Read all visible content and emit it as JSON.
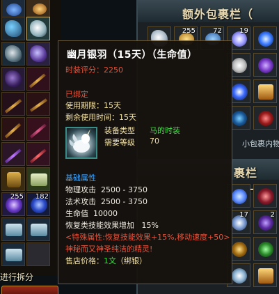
{
  "tooltip": {
    "title": "幽月银羽（15天）（生命值）",
    "score_label": "时装评分：",
    "score_value": "2250",
    "bound": "已绑定",
    "use_period_label": "使用期限：",
    "use_period_value": "15天",
    "remaining_label": "剩余使用时间：",
    "remaining_value": "15天",
    "equip_type_label": "装备类型",
    "equip_type_value": "马的时装",
    "req_level_label": "需要等级",
    "req_level_value": "70",
    "base_attr_header": "基础属性",
    "phys_atk_label": "物理攻击",
    "phys_atk_value": "2500 - 3750",
    "magic_atk_label": "法术攻击",
    "magic_atk_value": "2500 - 3750",
    "hp_label": "生命值",
    "hp_value": "10000",
    "recovery_label": "恢复类技能效果增加",
    "recovery_value": "15%",
    "special_attr": "<特殊属性:恢复技能效果+15%,移动速度+50>",
    "flavor": "神秘而又神圣纯洁的精灵!",
    "price_label": "售店价格：",
    "price_value": "1文",
    "price_bound": "（绑银）"
  },
  "right_panel_top": {
    "title": "额外包裹栏（",
    "slot_counts": [
      "255",
      "72",
      "19"
    ],
    "faded_counts": [
      "15",
      "20"
    ],
    "ghost_text": "小包裹内物"
  },
  "right_panel_bottom": {
    "title": "裹栏（一",
    "faded_title": "额外包",
    "slot_counts": [
      "17",
      "2"
    ]
  },
  "left_inventory": {
    "slot_counts": [
      "255",
      "182"
    ],
    "split_label": "进行拆分"
  },
  "colors": {
    "title": "#ffffff",
    "score": "#e8533a",
    "bound": "#e8533a",
    "equip_value": "#46e04a",
    "base_header": "#3fa7ff",
    "special": "#e8533a",
    "flavor": "#e8533a"
  }
}
